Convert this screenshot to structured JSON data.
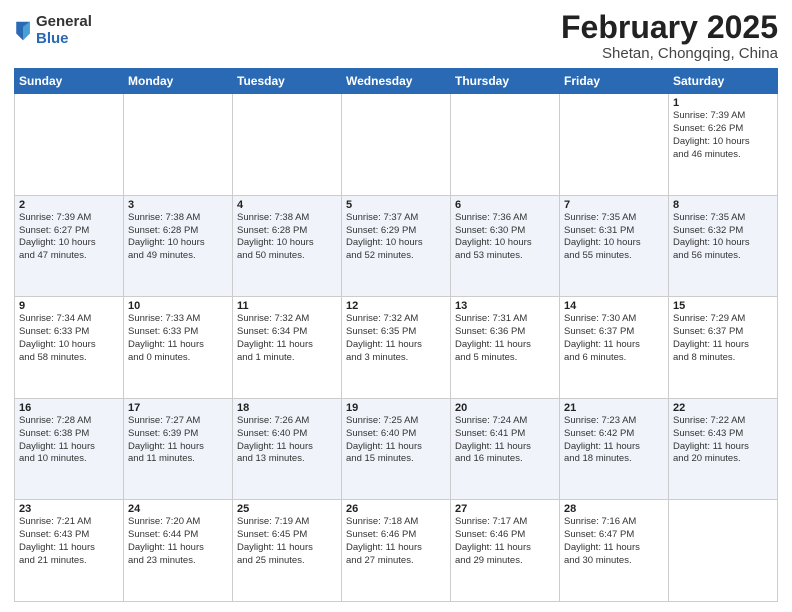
{
  "logo": {
    "general": "General",
    "blue": "Blue"
  },
  "header": {
    "month": "February 2025",
    "location": "Shetan, Chongqing, China"
  },
  "weekdays": [
    "Sunday",
    "Monday",
    "Tuesday",
    "Wednesday",
    "Thursday",
    "Friday",
    "Saturday"
  ],
  "weeks": [
    [
      {
        "day": "",
        "info": ""
      },
      {
        "day": "",
        "info": ""
      },
      {
        "day": "",
        "info": ""
      },
      {
        "day": "",
        "info": ""
      },
      {
        "day": "",
        "info": ""
      },
      {
        "day": "",
        "info": ""
      },
      {
        "day": "1",
        "info": "Sunrise: 7:39 AM\nSunset: 6:26 PM\nDaylight: 10 hours\nand 46 minutes."
      }
    ],
    [
      {
        "day": "2",
        "info": "Sunrise: 7:39 AM\nSunset: 6:27 PM\nDaylight: 10 hours\nand 47 minutes."
      },
      {
        "day": "3",
        "info": "Sunrise: 7:38 AM\nSunset: 6:28 PM\nDaylight: 10 hours\nand 49 minutes."
      },
      {
        "day": "4",
        "info": "Sunrise: 7:38 AM\nSunset: 6:28 PM\nDaylight: 10 hours\nand 50 minutes."
      },
      {
        "day": "5",
        "info": "Sunrise: 7:37 AM\nSunset: 6:29 PM\nDaylight: 10 hours\nand 52 minutes."
      },
      {
        "day": "6",
        "info": "Sunrise: 7:36 AM\nSunset: 6:30 PM\nDaylight: 10 hours\nand 53 minutes."
      },
      {
        "day": "7",
        "info": "Sunrise: 7:35 AM\nSunset: 6:31 PM\nDaylight: 10 hours\nand 55 minutes."
      },
      {
        "day": "8",
        "info": "Sunrise: 7:35 AM\nSunset: 6:32 PM\nDaylight: 10 hours\nand 56 minutes."
      }
    ],
    [
      {
        "day": "9",
        "info": "Sunrise: 7:34 AM\nSunset: 6:33 PM\nDaylight: 10 hours\nand 58 minutes."
      },
      {
        "day": "10",
        "info": "Sunrise: 7:33 AM\nSunset: 6:33 PM\nDaylight: 11 hours\nand 0 minutes."
      },
      {
        "day": "11",
        "info": "Sunrise: 7:32 AM\nSunset: 6:34 PM\nDaylight: 11 hours\nand 1 minute."
      },
      {
        "day": "12",
        "info": "Sunrise: 7:32 AM\nSunset: 6:35 PM\nDaylight: 11 hours\nand 3 minutes."
      },
      {
        "day": "13",
        "info": "Sunrise: 7:31 AM\nSunset: 6:36 PM\nDaylight: 11 hours\nand 5 minutes."
      },
      {
        "day": "14",
        "info": "Sunrise: 7:30 AM\nSunset: 6:37 PM\nDaylight: 11 hours\nand 6 minutes."
      },
      {
        "day": "15",
        "info": "Sunrise: 7:29 AM\nSunset: 6:37 PM\nDaylight: 11 hours\nand 8 minutes."
      }
    ],
    [
      {
        "day": "16",
        "info": "Sunrise: 7:28 AM\nSunset: 6:38 PM\nDaylight: 11 hours\nand 10 minutes."
      },
      {
        "day": "17",
        "info": "Sunrise: 7:27 AM\nSunset: 6:39 PM\nDaylight: 11 hours\nand 11 minutes."
      },
      {
        "day": "18",
        "info": "Sunrise: 7:26 AM\nSunset: 6:40 PM\nDaylight: 11 hours\nand 13 minutes."
      },
      {
        "day": "19",
        "info": "Sunrise: 7:25 AM\nSunset: 6:40 PM\nDaylight: 11 hours\nand 15 minutes."
      },
      {
        "day": "20",
        "info": "Sunrise: 7:24 AM\nSunset: 6:41 PM\nDaylight: 11 hours\nand 16 minutes."
      },
      {
        "day": "21",
        "info": "Sunrise: 7:23 AM\nSunset: 6:42 PM\nDaylight: 11 hours\nand 18 minutes."
      },
      {
        "day": "22",
        "info": "Sunrise: 7:22 AM\nSunset: 6:43 PM\nDaylight: 11 hours\nand 20 minutes."
      }
    ],
    [
      {
        "day": "23",
        "info": "Sunrise: 7:21 AM\nSunset: 6:43 PM\nDaylight: 11 hours\nand 21 minutes."
      },
      {
        "day": "24",
        "info": "Sunrise: 7:20 AM\nSunset: 6:44 PM\nDaylight: 11 hours\nand 23 minutes."
      },
      {
        "day": "25",
        "info": "Sunrise: 7:19 AM\nSunset: 6:45 PM\nDaylight: 11 hours\nand 25 minutes."
      },
      {
        "day": "26",
        "info": "Sunrise: 7:18 AM\nSunset: 6:46 PM\nDaylight: 11 hours\nand 27 minutes."
      },
      {
        "day": "27",
        "info": "Sunrise: 7:17 AM\nSunset: 6:46 PM\nDaylight: 11 hours\nand 29 minutes."
      },
      {
        "day": "28",
        "info": "Sunrise: 7:16 AM\nSunset: 6:47 PM\nDaylight: 11 hours\nand 30 minutes."
      },
      {
        "day": "",
        "info": ""
      }
    ]
  ]
}
